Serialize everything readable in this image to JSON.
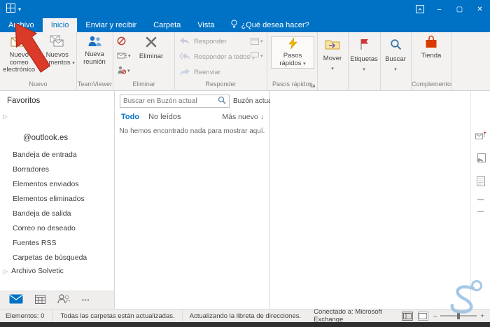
{
  "colors": {
    "titlebar_blue": "#0072C6",
    "accent_blue": "#0072C6",
    "annotation_arrow_red": "#DC3A28",
    "store_red": "#D83B01"
  },
  "tabs": {
    "file": "Archivo",
    "home": "Inicio",
    "send_receive": "Enviar y recibir",
    "folder": "Carpeta",
    "view": "Vista",
    "tell_me": "¿Qué desea hacer?"
  },
  "window_controls": {
    "minimize": "–",
    "maximize": "▢",
    "close": "✕"
  },
  "ribbon": {
    "new_email": "Nuevo correo electrónico",
    "new_items": "Nuevos elementos",
    "group_new": "Nuevo",
    "new_meeting": "Nueva reunión",
    "group_teamviewer": "TeamViewer",
    "delete": "Eliminar",
    "group_delete": "Eliminar",
    "reply": "Responder",
    "reply_all": "Responder a todos",
    "forward": "Reenviar",
    "group_respond": "Responder",
    "quick_steps": "Pasos rápidos",
    "group_quick_steps": "Pasos rápidos",
    "move": "Mover",
    "tags": "Etiquetas",
    "search": "Buscar",
    "store": "Tienda",
    "group_addins": "Complementos"
  },
  "sidebar": {
    "favorites": "Favoritos",
    "account": "@outlook.es",
    "folders": [
      "Bandeja de entrada",
      "Borradores",
      "Elementos enviados",
      "Elementos eliminados",
      "Bandeja de salida",
      "Correo no deseado",
      "Fuentes RSS",
      "Carpetas de búsqueda"
    ],
    "archive_group": "Archivo Solvetic"
  },
  "list": {
    "search_placeholder": "Buscar en Buzón actual",
    "scope": "Buzón actual",
    "filter_all": "Todo",
    "filter_unread": "No leídos",
    "sort_label": "Más nuevo",
    "empty_message": "No hemos encontrado nada para mostrar aquí."
  },
  "status": {
    "items_count": "Elementos: 0",
    "folders_status": "Todas las carpetas están actualizadas.",
    "address_book": "Actualizando la libreta de direcciones.",
    "connection": "Conectado a: Microsoft Exchange"
  },
  "icons": {
    "caret_down": "▾",
    "sort_down": "↓",
    "triangle_right": "▷",
    "ellipsis": "•••",
    "minus": "–",
    "plus": "+"
  }
}
